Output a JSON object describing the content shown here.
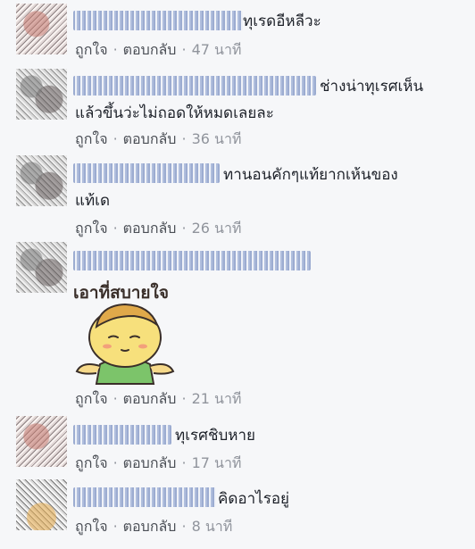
{
  "actions": {
    "like": "ถูกใจ",
    "reply": "ตอบกลับ",
    "separator": "·"
  },
  "comments": [
    {
      "text1": "ทุเรดอีหลีวะ",
      "text2": "",
      "time": "47 นาที"
    },
    {
      "text1": "ช่างน่าทุเรศเห็น",
      "text2": "แล้วขึ้นว่ะไม่ถอดให้หมดเลยละ",
      "time": "36 นาที"
    },
    {
      "text1": "ทานอนคักๆแท้ยากเห้นของ",
      "text2": "แท้เด",
      "time": "26 นาที"
    },
    {
      "text1": "",
      "text2": "",
      "time": "21 นาที",
      "sticker_caption": "เอาที่สบายใจ"
    },
    {
      "text1": "ทุเรศชิบหาย",
      "text2": "",
      "time": "17 นาที"
    },
    {
      "text1": "คิดอาไรอยู่",
      "text2": "",
      "time": "8 นาที"
    }
  ]
}
